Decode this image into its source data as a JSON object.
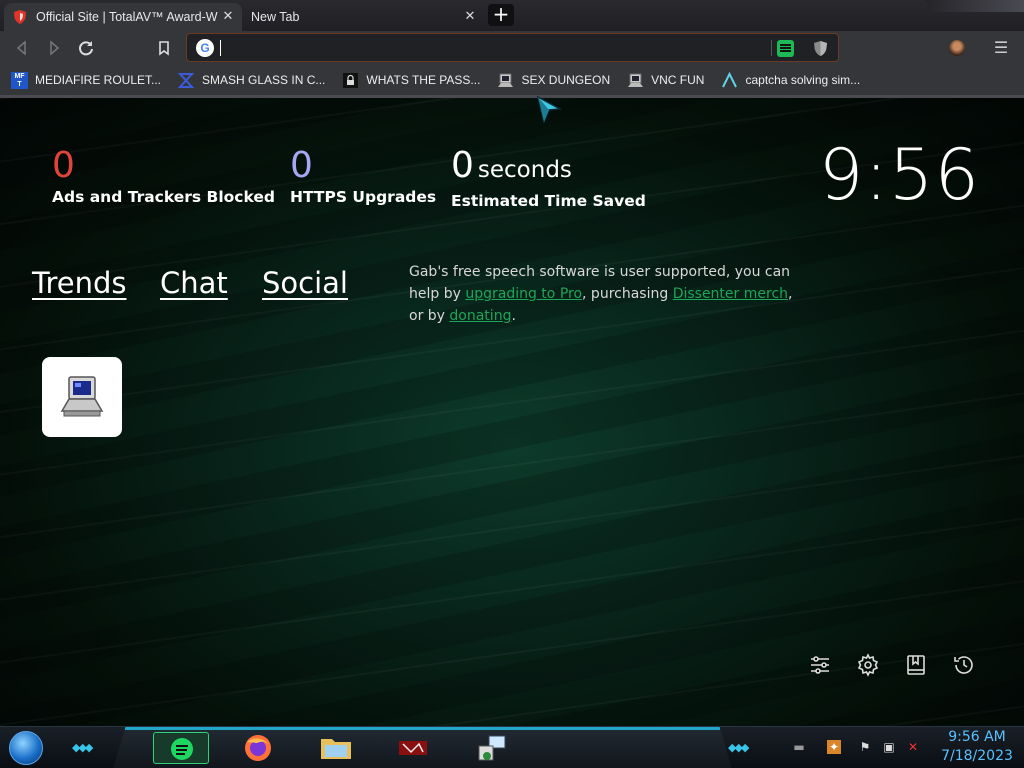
{
  "tabs": [
    {
      "title": "Official Site | TotalAV™ Award-Win",
      "active": true
    },
    {
      "title": "New Tab",
      "active": false
    }
  ],
  "toolbar": {
    "omnibox_value": "",
    "omnibox_placeholder": ""
  },
  "bookmarks": [
    {
      "label": "MEDIAFIRE ROULET...",
      "icon": "mediafire-icon",
      "icon_text": "MF T"
    },
    {
      "label": "SMASH GLASS IN C...",
      "icon": "smash-glass-icon"
    },
    {
      "label": "WHATS THE PASS...",
      "icon": "whats-pass-icon"
    },
    {
      "label": "SEX DUNGEON",
      "icon": "computer-icon"
    },
    {
      "label": "VNC FUN",
      "icon": "computer-icon"
    },
    {
      "label": "captcha solving sim...",
      "icon": "captcha-icon"
    }
  ],
  "stats": {
    "ads_blocked": {
      "value": "0",
      "label": "Ads and Trackers Blocked",
      "color": "#e1453a"
    },
    "https_upgrades": {
      "value": "0",
      "label": "HTTPS Upgrades",
      "color": "#a6a7f0"
    },
    "time_saved": {
      "value": "0",
      "unit": "seconds",
      "label": "Estimated Time Saved"
    }
  },
  "clock": "9:56",
  "links": {
    "trends": "Trends",
    "chat": "Chat",
    "social": "Social"
  },
  "gab": {
    "text1": "Gab's free speech software is user supported, you can help by ",
    "link1": "upgrading to Pro",
    "text2": ", purchasing ",
    "link2": "Dissenter merch",
    "text3": ", or by ",
    "link3": "donating",
    "text4": "."
  },
  "taskbar": {
    "time": "9:56 AM",
    "date": "7/18/2023"
  },
  "colors": {
    "accent_green": "#1fa558",
    "taskbar_accent": "#39c4e8"
  }
}
